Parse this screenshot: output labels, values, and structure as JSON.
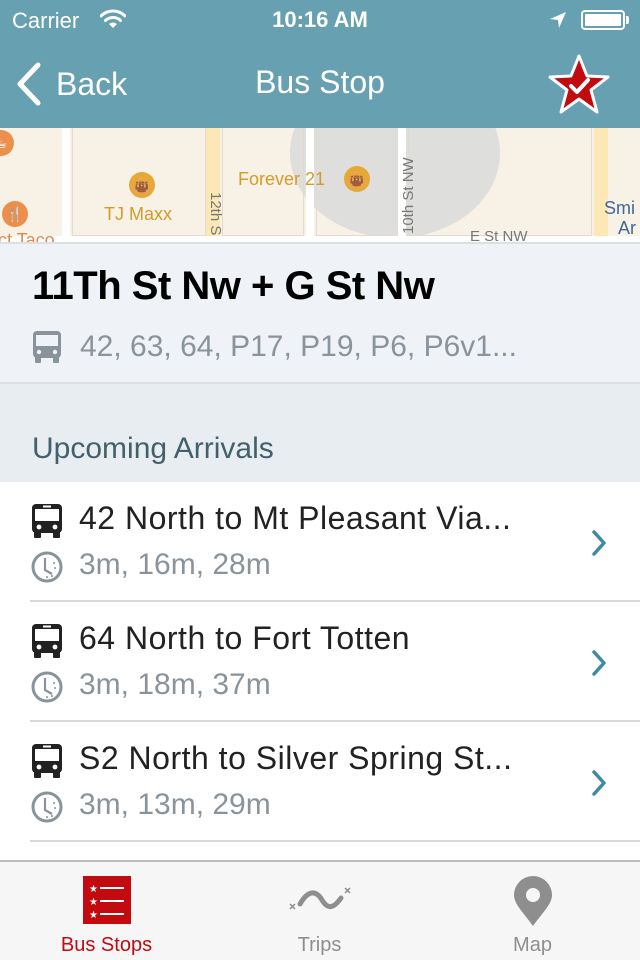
{
  "status_bar": {
    "carrier": "Carrier",
    "time": "10:16 AM",
    "battery_level": 1.0
  },
  "nav": {
    "back_label": "Back",
    "title": "Bus Stop",
    "favorite_icon": "star-check-icon",
    "favorited": true
  },
  "map": {
    "labels": {
      "tj_maxx": "TJ Maxx",
      "forever21": "Forever 21",
      "street_12th": "12th S",
      "street_10th": "10th St NW",
      "street_e": "E St NW",
      "taco": "ict Taco",
      "smithsonian_1": "Smi",
      "smithsonian_2": "Ar"
    }
  },
  "stop": {
    "name": "11Th St Nw + G St Nw",
    "routes": "42, 63, 64, P17, P19, P6, P6v1..."
  },
  "section": {
    "title": "Upcoming Arrivals"
  },
  "arrivals": [
    {
      "title": "42 North to Mt Pleasant Via...",
      "times": "3m, 16m, 28m"
    },
    {
      "title": "64 North to Fort Totten",
      "times": "3m, 18m, 37m"
    },
    {
      "title": "S2 North to Silver Spring St...",
      "times": "3m, 13m, 29m"
    }
  ],
  "tabs": [
    {
      "label": "Bus Stops",
      "icon": "starred-list-icon",
      "active": true
    },
    {
      "label": "Trips",
      "icon": "route-icon",
      "active": false
    },
    {
      "label": "Map",
      "icon": "map-pin-icon",
      "active": false
    }
  ],
  "colors": {
    "nav_bar": "#67a0b1",
    "accent_red": "#c20a0f",
    "chevron": "#3d8aa3",
    "secondary_text": "#88939b"
  }
}
